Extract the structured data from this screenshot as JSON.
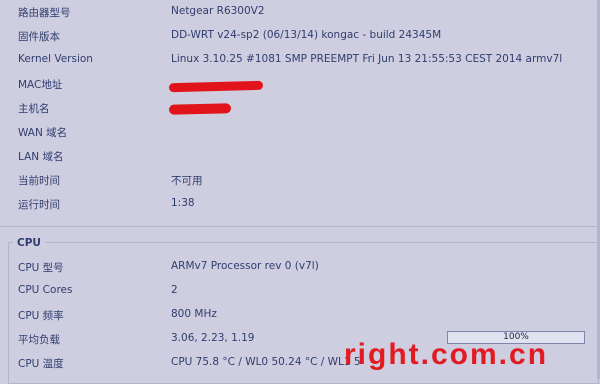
{
  "system": {
    "rows": [
      {
        "label": "路由器型号",
        "value": "Netgear R6300V2"
      },
      {
        "label": "固件版本",
        "value": "DD-WRT v24-sp2 (06/13/14) kongac - build 24345M"
      },
      {
        "label": "Kernel Version",
        "value": "Linux 3.10.25 #1081 SMP PREEMPT Fri Jun 13 21:55:53 CEST 2014 armv7l"
      },
      {
        "label": "MAC地址",
        "value": ""
      },
      {
        "label": "主机名",
        "value": ""
      },
      {
        "label": "WAN 域名",
        "value": ""
      },
      {
        "label": "LAN 域名",
        "value": ""
      },
      {
        "label": "当前时间",
        "value": "不可用"
      },
      {
        "label": "运行时间",
        "value": "1:38"
      }
    ]
  },
  "cpu": {
    "legend": "CPU",
    "rows": [
      {
        "label": "CPU 型号",
        "value": "ARMv7 Processor rev 0 (v7l)"
      },
      {
        "label": "CPU Cores",
        "value": "2"
      },
      {
        "label": "CPU 频率",
        "value": "800 MHz"
      },
      {
        "label": "平均负载",
        "value": "3.06, 2.23, 1.19"
      },
      {
        "label": "CPU 温度",
        "value": "CPU 75.8 °C / WL0 50.24 °C / WL1 5"
      }
    ],
    "load_bar": {
      "label": "100%",
      "percent": 100
    }
  },
  "watermark": "right.com.cn",
  "colors": {
    "background": "#cfcde0",
    "text": "#2f3e6e",
    "redaction": "#e0141a",
    "watermark": "#e21a22"
  }
}
